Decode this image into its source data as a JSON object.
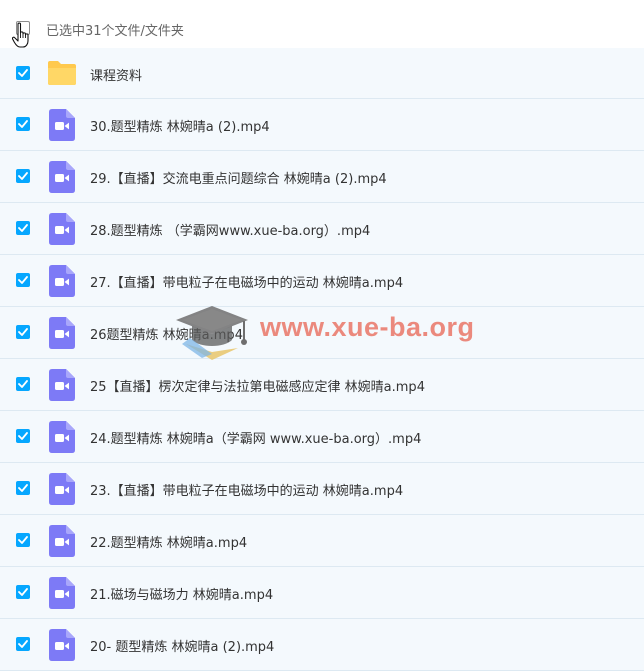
{
  "header": {
    "selection_label": "已选中31个文件/文件夹",
    "checkbox_state": "partial"
  },
  "colors": {
    "checkbox": "#06a7ff",
    "row_background": "#f4f9fd",
    "folder": "#ffc94d",
    "video_icon": "#7d7af6",
    "watermark": "#e96e5e"
  },
  "files": [
    {
      "name": "课程资料",
      "type": "folder",
      "icon": "folder-icon",
      "checked": true
    },
    {
      "name": "30.题型精炼 林婉晴a (2).mp4",
      "type": "video",
      "icon": "video-file-icon",
      "checked": true
    },
    {
      "name": "29.【直播】交流电重点问题综合 林婉晴a (2).mp4",
      "type": "video",
      "icon": "video-file-icon",
      "checked": true
    },
    {
      "name": "28.题型精炼 （学霸网www.xue-ba.org）.mp4",
      "type": "video",
      "icon": "video-file-icon",
      "checked": true
    },
    {
      "name": "27.【直播】带电粒子在电磁场中的运动 林婉晴a.mp4",
      "type": "video",
      "icon": "video-file-icon",
      "checked": true
    },
    {
      "name": "26题型精炼 林婉晴a.mp4",
      "type": "video",
      "icon": "video-file-icon",
      "checked": true
    },
    {
      "name": "25【直播】楞次定律与法拉第电磁感应定律 林婉晴a.mp4",
      "type": "video",
      "icon": "video-file-icon",
      "checked": true
    },
    {
      "name": "24.题型精炼 林婉晴a（学霸网 www.xue-ba.org）.mp4",
      "type": "video",
      "icon": "video-file-icon",
      "checked": true
    },
    {
      "name": "23.【直播】带电粒子在电磁场中的运动 林婉晴a.mp4",
      "type": "video",
      "icon": "video-file-icon",
      "checked": true
    },
    {
      "name": "22.题型精炼 林婉晴a.mp4",
      "type": "video",
      "icon": "video-file-icon",
      "checked": true
    },
    {
      "name": "21.磁场与磁场力 林婉晴a.mp4",
      "type": "video",
      "icon": "video-file-icon",
      "checked": true
    },
    {
      "name": "20- 题型精炼 林婉晴a (2).mp4",
      "type": "video",
      "icon": "video-file-icon",
      "checked": true
    }
  ],
  "watermark": {
    "text": "www.xue-ba.org",
    "icon": "graduation-cap-logo"
  }
}
